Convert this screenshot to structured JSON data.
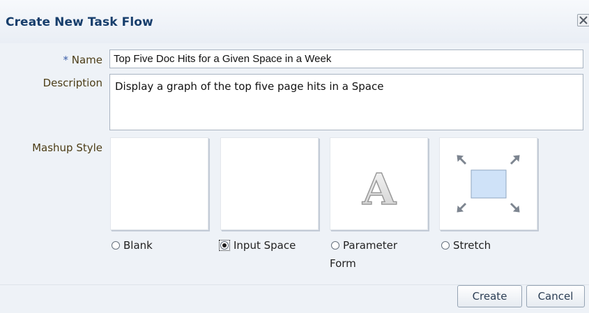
{
  "dialog": {
    "title": "Create New Task Flow",
    "close_icon": "close-icon"
  },
  "form": {
    "name": {
      "required_marker": "*",
      "label": "Name",
      "value": "Top Five Doc Hits for a Given Space in a Week"
    },
    "description": {
      "label": "Description",
      "value": "Display a graph of the top five page hits in a Space"
    },
    "mashup_style": {
      "label": "Mashup Style",
      "selected": "Input Space",
      "options": [
        {
          "label": "Blank",
          "thumbnail": "blank"
        },
        {
          "label": "Input Space",
          "thumbnail": "blank"
        },
        {
          "label_line1": "Parameter",
          "label_line2": "Form",
          "thumbnail": "letter-a-icon",
          "thumbnail_letter": "A"
        },
        {
          "label": "Stretch",
          "thumbnail": "stretch-icon"
        }
      ]
    }
  },
  "buttons": {
    "create": "Create",
    "cancel": "Cancel"
  },
  "colors": {
    "title": "#173e6c",
    "label": "#4c3d16",
    "background": "#eef2f7"
  }
}
